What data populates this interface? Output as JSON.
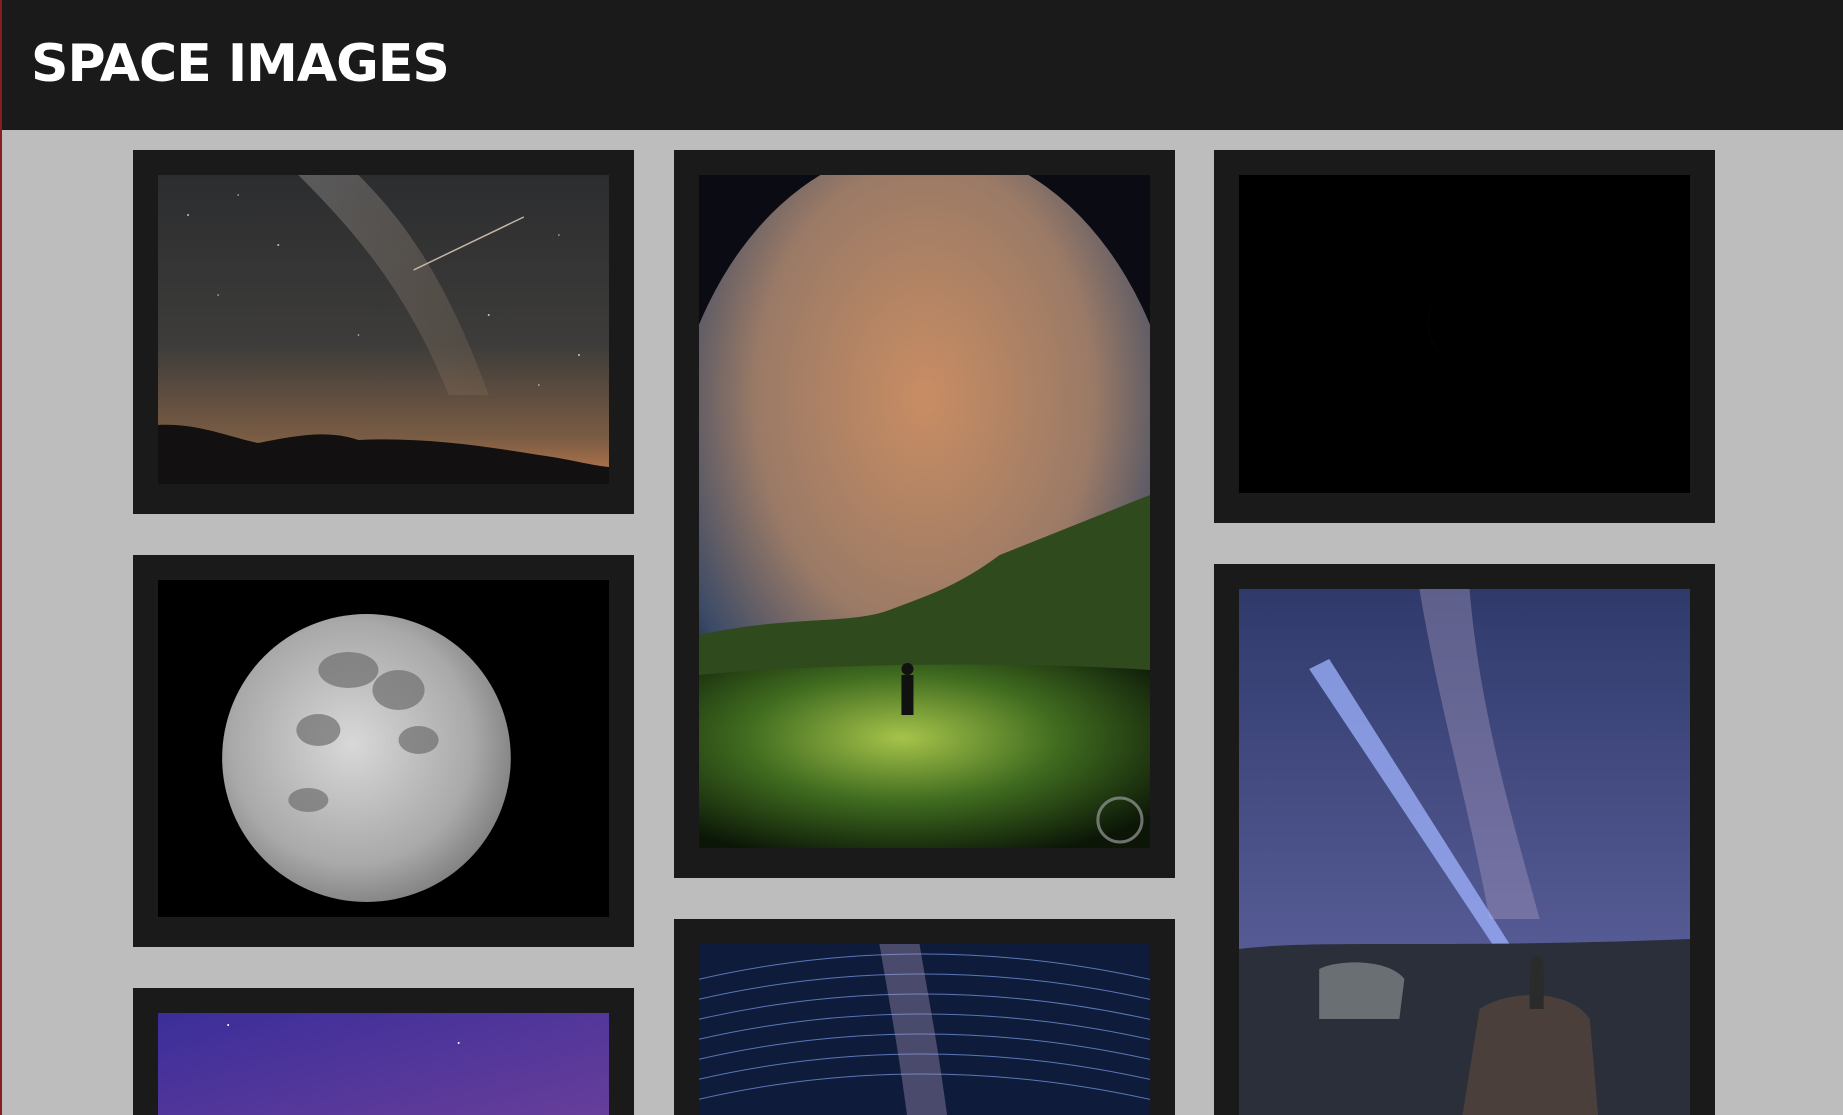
{
  "header": {
    "title": "Space Images"
  },
  "colors": {
    "background": "#bdbdbd",
    "header": "#1b1a1a",
    "card_frame": "#1b1a1a",
    "title_text": "#ffffff"
  },
  "gallery": {
    "images": [
      {
        "subject": "milky-way-meteor-over-hills"
      },
      {
        "subject": "fisheye-night-sky-person-with-flashlight"
      },
      {
        "subject": "half-moon-black-sky"
      },
      {
        "subject": "full-moon"
      },
      {
        "subject": "star-trails-milky-way"
      },
      {
        "subject": "person-with-flashlight-beam-milky-way-lake"
      },
      {
        "subject": "purple-twilight-sky"
      }
    ]
  }
}
